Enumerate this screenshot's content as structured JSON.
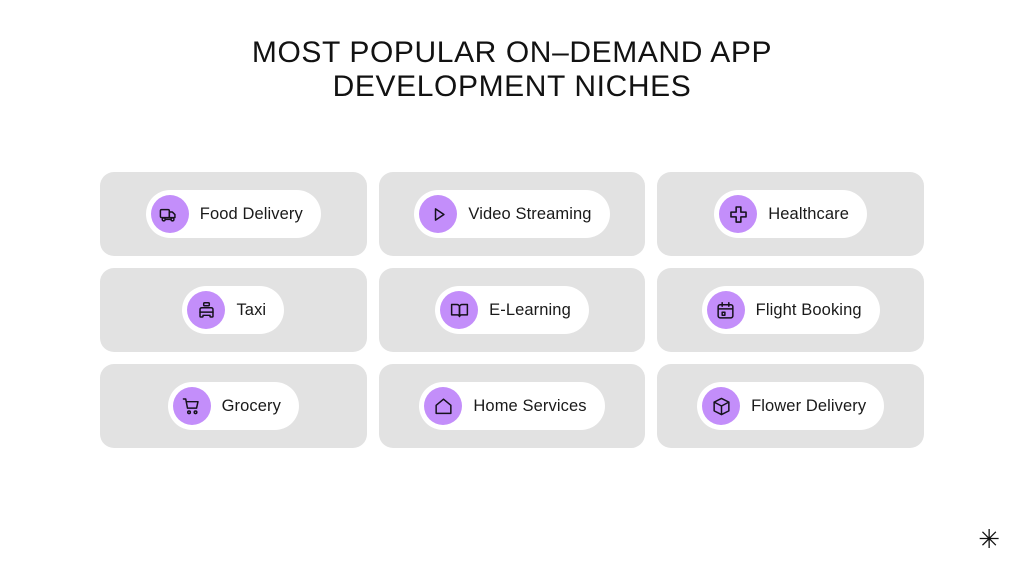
{
  "slide": {
    "background_color": "#ffffff",
    "title": "MOST POPULAR ON–DEMAND APP\nDEVELOPMENT NICHES",
    "corner_mark": "✳"
  },
  "theme": {
    "card_background": "#e2e2e2",
    "pill_background": "#ffffff",
    "badge_color": "#c38efa",
    "text_color": "#1a1a1a",
    "title_color": "#121212"
  },
  "cards": [
    {
      "label": "Food Delivery",
      "icon": "delivery-truck-icon"
    },
    {
      "label": "Video Streaming",
      "icon": "play-circle-icon"
    },
    {
      "label": "Healthcare",
      "icon": "medical-cross-icon"
    },
    {
      "label": "Taxi",
      "icon": "taxi-cab-icon"
    },
    {
      "label": "E-Learning",
      "icon": "open-book-icon"
    },
    {
      "label": "Flight Booking",
      "icon": "calendar-icon"
    },
    {
      "label": "Grocery",
      "icon": "shopping-cart-icon"
    },
    {
      "label": "Home Services",
      "icon": "house-icon"
    },
    {
      "label": "Flower Delivery",
      "icon": "package-box-icon"
    }
  ]
}
